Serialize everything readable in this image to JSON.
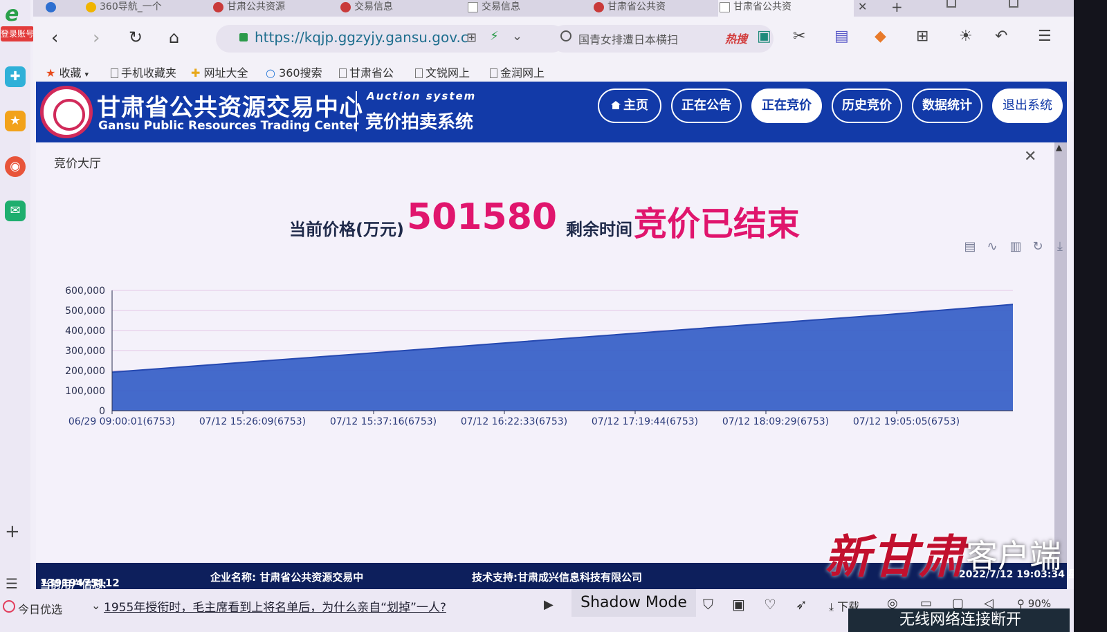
{
  "browser": {
    "tabs": [
      {
        "label": "360导航_一个"
      },
      {
        "label": "甘肃公共资源"
      },
      {
        "label": "交易信息"
      },
      {
        "label": "交易信息"
      },
      {
        "label": "甘肃省公共资"
      },
      {
        "label": "甘肃省公共资"
      }
    ],
    "address": "https://kqjp.ggzyjy.gansu.gov.c",
    "search_text": "国青女排遭日本横扫",
    "search_hot": "热搜",
    "login_badge": "登录账号",
    "bookmarks": [
      {
        "label": "收藏"
      },
      {
        "label": "手机收藏夹"
      },
      {
        "label": "网址大全"
      },
      {
        "label": "360搜索"
      },
      {
        "label": "甘肃省公"
      },
      {
        "label": "文锐网上"
      },
      {
        "label": "金润网上"
      }
    ]
  },
  "site": {
    "title_cn": "甘肃省公共资源交易中心",
    "title_en": "Gansu Public Resources Trading Center",
    "system_en": "Auction system",
    "system_cn": "竞价拍卖系统",
    "nav": [
      {
        "label": "主页"
      },
      {
        "label": "正在公告"
      },
      {
        "label": "正在竞价"
      },
      {
        "label": "历史竞价"
      },
      {
        "label": "数据统计"
      },
      {
        "label": "退出系统"
      }
    ]
  },
  "panel": {
    "title": "竞价大厅",
    "price_label": "当前价格(万元)",
    "price_value": "501580",
    "remain_label": "剩余时间",
    "remain_value": "竞价已结束"
  },
  "chart_data": {
    "type": "area",
    "ylim": [
      0,
      600000
    ],
    "y_ticks": [
      "600,000",
      "500,000",
      "400,000",
      "300,000",
      "200,000",
      "100,000",
      "0"
    ],
    "x_tick_labels": [
      "06/29 09:00:01(6753)",
      "07/12 15:26:09(6753)",
      "07/12 15:37:16(6753)",
      "07/12 16:22:33(6753)",
      "07/12 17:19:44(6753)",
      "07/12 18:09:29(6753)",
      "07/12 19:05:05(6753)"
    ],
    "x": [
      "06/29 09:00:01(6753)",
      "07/12 15:26:09(6753)",
      "07/12 15:37:16(6753)",
      "07/12 16:22:33(6753)",
      "07/12 17:19:44(6753)",
      "07/12 18:09:29(6753)",
      "07/12 19:05:05(6753)"
    ],
    "values": [
      192000,
      240000,
      287000,
      335000,
      383000,
      431000,
      478000,
      530000
    ],
    "color": "#3a62c8",
    "grid": true
  },
  "info_bar": {
    "user_label": "当前用户信息:",
    "user_value": "13919475112",
    "company": "企业名称: 甘肃省公共资源交易中",
    "tech": "技术支持:甘肃成兴信息科技有限公司",
    "clock": "2022/7/12 19:03:34 星期二"
  },
  "bottom_bar": {
    "today": "今日优选",
    "news": "1955年授衔时，毛主席看到上将名单后，为什么亲自“划掉”一人?",
    "shadow_mode": "Shadow Mode",
    "download": "下载",
    "zoom": "90%"
  },
  "watermark": {
    "logo": "新甘肃",
    "text": "客户端"
  },
  "toast": "无线网络连接断开"
}
